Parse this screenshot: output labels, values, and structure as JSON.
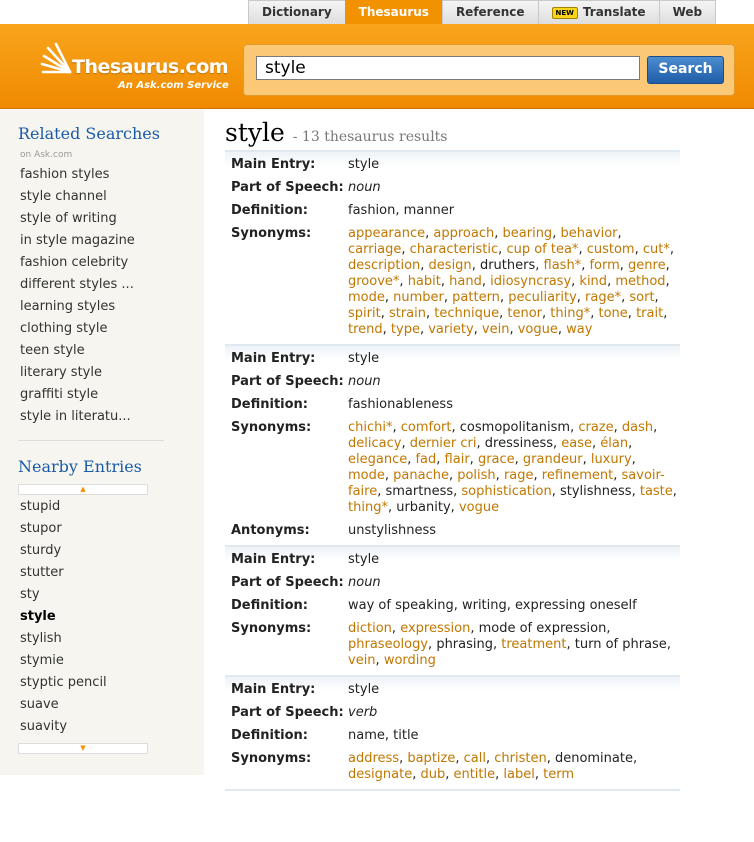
{
  "nav": {
    "tabs": [
      {
        "label": "Dictionary",
        "active": false
      },
      {
        "label": "Thesaurus",
        "active": true
      },
      {
        "label": "Reference",
        "active": false
      },
      {
        "label": "Translate",
        "active": false,
        "badge": "NEW"
      },
      {
        "label": "Web",
        "active": false
      }
    ]
  },
  "brand": {
    "logo_text": "Thesaurus.com",
    "logo_sub": "An Ask.com Service"
  },
  "search": {
    "value": "style",
    "button_label": "Search"
  },
  "sidebar": {
    "related_title": "Related Searches",
    "related_source": "on Ask.com",
    "related": [
      "fashion styles",
      "style channel",
      "style of writing",
      "in style magazine",
      "fashion celebrity",
      "different styles ...",
      "learning styles",
      "clothing style",
      "teen style",
      "literary style",
      "graffiti style",
      "style in literatu..."
    ],
    "nearby_title": "Nearby Entries",
    "nearby": [
      "stupid",
      "stupor",
      "sturdy",
      "stutter",
      "sty",
      "style",
      "stylish",
      "stymie",
      "styptic pencil",
      "suave",
      "suavity"
    ],
    "nearby_current": "style"
  },
  "results": {
    "word": "style",
    "count_text": "- 13 thesaurus results",
    "labels": {
      "main_entry": "Main Entry:",
      "pos": "Part of Speech:",
      "definition": "Definition:",
      "synonyms": "Synonyms:",
      "antonyms": "Antonyms:"
    },
    "entries": [
      {
        "main_entry": "style",
        "pos": "noun",
        "definition": "fashion, manner",
        "synonyms": [
          {
            "t": "appearance",
            "l": true
          },
          {
            "t": "approach",
            "l": true
          },
          {
            "t": "bearing",
            "l": true
          },
          {
            "t": "behavior",
            "l": true
          },
          {
            "t": "carriage",
            "l": true
          },
          {
            "t": "characteristic",
            "l": true
          },
          {
            "t": "cup of tea*",
            "l": true
          },
          {
            "t": "custom",
            "l": true
          },
          {
            "t": "cut*",
            "l": true
          },
          {
            "t": "description",
            "l": true
          },
          {
            "t": "design",
            "l": true
          },
          {
            "t": "druthers",
            "l": false
          },
          {
            "t": "flash*",
            "l": true
          },
          {
            "t": "form",
            "l": true
          },
          {
            "t": "genre",
            "l": true
          },
          {
            "t": "groove*",
            "l": true
          },
          {
            "t": "habit",
            "l": true
          },
          {
            "t": "hand",
            "l": true
          },
          {
            "t": "idiosyncrasy",
            "l": true
          },
          {
            "t": "kind",
            "l": true
          },
          {
            "t": "method",
            "l": true
          },
          {
            "t": "mode",
            "l": true
          },
          {
            "t": "number",
            "l": true
          },
          {
            "t": "pattern",
            "l": true
          },
          {
            "t": "peculiarity",
            "l": true
          },
          {
            "t": "rage*",
            "l": true
          },
          {
            "t": "sort",
            "l": true
          },
          {
            "t": "spirit",
            "l": true
          },
          {
            "t": "strain",
            "l": true
          },
          {
            "t": "technique",
            "l": true
          },
          {
            "t": "tenor",
            "l": true
          },
          {
            "t": "thing*",
            "l": true
          },
          {
            "t": "tone",
            "l": true
          },
          {
            "t": "trait",
            "l": true
          },
          {
            "t": "trend",
            "l": true
          },
          {
            "t": "type",
            "l": true
          },
          {
            "t": "variety",
            "l": true
          },
          {
            "t": "vein",
            "l": true
          },
          {
            "t": "vogue",
            "l": true
          },
          {
            "t": "way",
            "l": true
          }
        ]
      },
      {
        "main_entry": "style",
        "pos": "noun",
        "definition": "fashionableness",
        "synonyms": [
          {
            "t": "chichi*",
            "l": true
          },
          {
            "t": "comfort",
            "l": true
          },
          {
            "t": "cosmopolitanism",
            "l": false
          },
          {
            "t": "craze",
            "l": true
          },
          {
            "t": "dash",
            "l": true
          },
          {
            "t": "delicacy",
            "l": true
          },
          {
            "t": "dernier cri",
            "l": true
          },
          {
            "t": "dressiness",
            "l": false
          },
          {
            "t": "ease",
            "l": true
          },
          {
            "t": "élan",
            "l": true
          },
          {
            "t": "elegance",
            "l": true
          },
          {
            "t": "fad",
            "l": true
          },
          {
            "t": "flair",
            "l": true
          },
          {
            "t": "grace",
            "l": true
          },
          {
            "t": "grandeur",
            "l": true
          },
          {
            "t": "luxury",
            "l": true
          },
          {
            "t": "mode",
            "l": true
          },
          {
            "t": "panache",
            "l": true
          },
          {
            "t": "polish",
            "l": true
          },
          {
            "t": "rage",
            "l": true
          },
          {
            "t": "refinement",
            "l": true
          },
          {
            "t": "savoir-faire",
            "l": true
          },
          {
            "t": "smartness",
            "l": false
          },
          {
            "t": "sophistication",
            "l": true
          },
          {
            "t": "stylishness",
            "l": false
          },
          {
            "t": "taste",
            "l": true
          },
          {
            "t": "thing*",
            "l": true
          },
          {
            "t": "urbanity",
            "l": false
          },
          {
            "t": "vogue",
            "l": true
          }
        ],
        "antonyms": "unstylishness"
      },
      {
        "main_entry": "style",
        "pos": "noun",
        "definition": "way of speaking, writing, expressing oneself",
        "synonyms": [
          {
            "t": "diction",
            "l": true
          },
          {
            "t": "expression",
            "l": true
          },
          {
            "t": "mode of expression",
            "l": false
          },
          {
            "t": "phraseology",
            "l": true
          },
          {
            "t": "phrasing",
            "l": false
          },
          {
            "t": "treatment",
            "l": true
          },
          {
            "t": "turn of phrase",
            "l": false
          },
          {
            "t": "vein",
            "l": true
          },
          {
            "t": "wording",
            "l": true
          }
        ]
      },
      {
        "main_entry": "style",
        "pos": "verb",
        "definition": "name, title",
        "synonyms": [
          {
            "t": "address",
            "l": true
          },
          {
            "t": "baptize",
            "l": true
          },
          {
            "t": "call",
            "l": true
          },
          {
            "t": "christen",
            "l": true
          },
          {
            "t": "denominate",
            "l": false
          },
          {
            "t": "designate",
            "l": true
          },
          {
            "t": "dub",
            "l": true
          },
          {
            "t": "entitle",
            "l": true
          },
          {
            "t": "label",
            "l": true
          },
          {
            "t": "term",
            "l": true
          }
        ]
      }
    ]
  },
  "colors": {
    "brand_orange": "#f39200",
    "link_orange": "#c07700",
    "heading_blue": "#1a5ba8"
  }
}
